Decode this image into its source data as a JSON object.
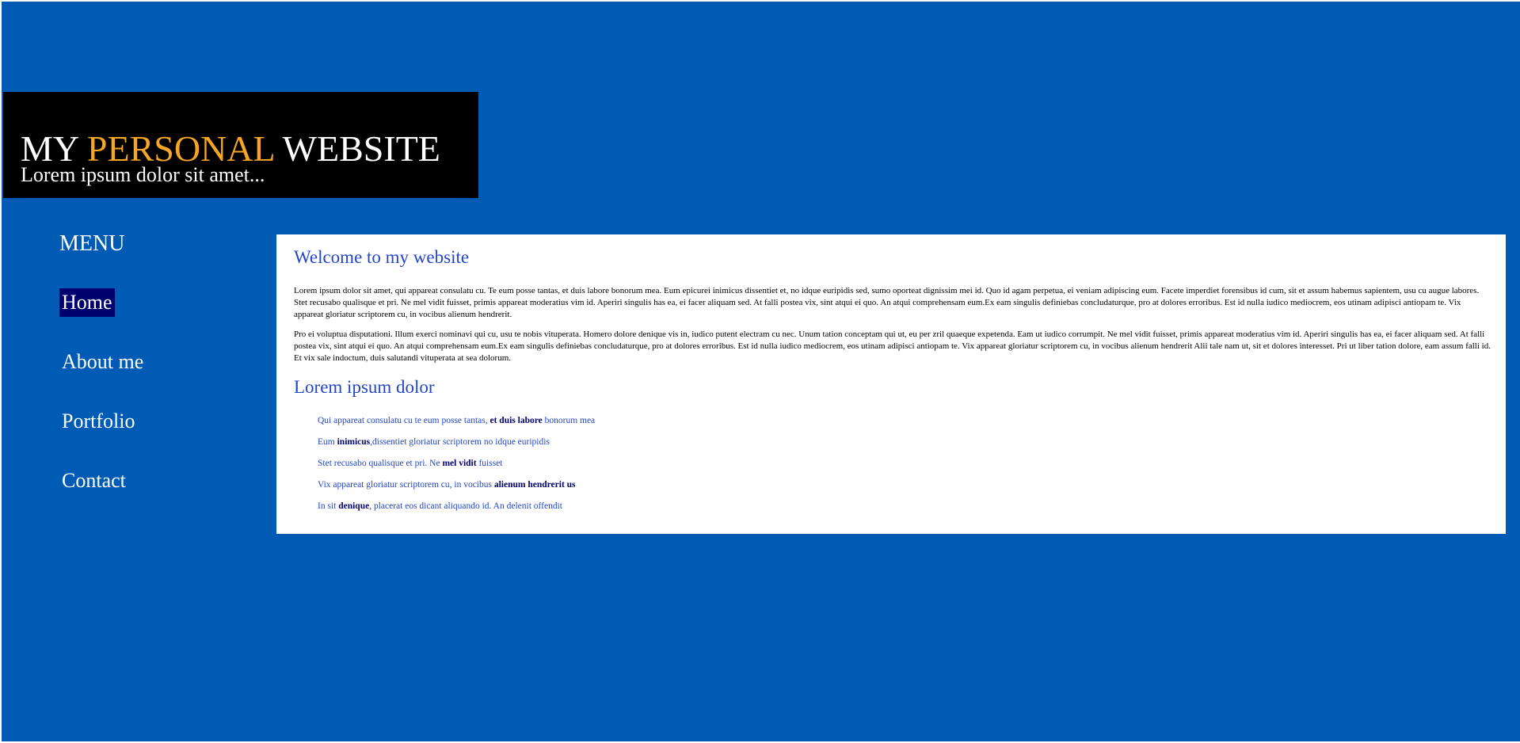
{
  "header": {
    "title_part1": "MY ",
    "title_accent": "PERSONAL",
    "title_part2": " WEBSITE",
    "tagline": "Lorem ipsum dolor sit amet..."
  },
  "menu": {
    "heading": "MENU",
    "items": [
      {
        "label": "Home",
        "active": true
      },
      {
        "label": "About me",
        "active": false
      },
      {
        "label": "Portfolio",
        "active": false
      },
      {
        "label": "Contact",
        "active": false
      }
    ]
  },
  "content": {
    "welcome_heading": "Welcome to my website",
    "paragraph1": "Lorem ipsum dolor sit amet, qui appareat consulatu cu. Te eum posse tantas, et duis labore bonorum mea. Eum epicurei inimicus dissentiet et, no idque euripidis sed, sumo oporteat dignissim mei id. Quo id agam perpetua, ei veniam adipiscing eum. Facete imperdiet forensibus id cum, sit et assum habemus sapientem, usu cu augue labores. Stet recusabo qualisque et pri. Ne mel vidit fuisset, primis appareat moderatius vim id. Aperiri singulis has ea, ei facer aliquam sed. At falli postea vix, sint atqui ei quo. An atqui comprehensam eum.Ex eam singulis definiebas concludaturque, pro at dolores erroribus. Est id nulla iudico mediocrem, eos utinam adipisci antiopam te. Vix appareat gloriatur scriptorem cu, in vocibus alienum hendrerit.",
    "paragraph2": "Pro ei voluptua disputationi. Illum exerci nominavi qui cu, usu te nobis vituperata. Homero dolore denique vis in, iudico putent electram cu nec. Unum tation conceptam qui ut, eu per zril quaeque expetenda. Eam ut iudico corrumpit. Ne mel vidit fuisset, primis appareat moderatius vim id. Aperiri singulis has ea, ei facer aliquam sed. At falli postea vix, sint atqui ei quo. An atqui comprehensam eum.Ex eam singulis definiebas concludaturque, pro at dolores erroribus. Est id nulla iudico mediocrem, eos utinam adipisci antiopam te. Vix appareat gloriatur scriptorem cu, in vocibus alienum hendrerit Alii tale nam ut, sit et dolores interesset. Pri ut liber tation dolore, eam assum falli id. Et vix sale indoctum, duis salutandi vituperata at sea dolorum.",
    "second_heading": "Lorem ipsum dolor",
    "list": [
      {
        "before": "Qui appareat consulatu cu te eum posse tantas, ",
        "bold": "et duis labore",
        "after": " bonorum mea"
      },
      {
        "before": "Eum ",
        "bold": "inimicus",
        "after": ",dissentiet gloriatur scriptorem no idque euripidis"
      },
      {
        "before": "Stet recusabo qualisque et pri. Ne ",
        "bold": "mel vidit",
        "after": " fuisset"
      },
      {
        "before": "Vix appareat gloriatur scriptorem cu, in vocibus ",
        "bold": "alienum hendrerit us",
        "after": ""
      },
      {
        "before": "In sit ",
        "bold": "denique",
        "after": ", placerat eos dicant aliquando id. An delenit offendit"
      }
    ]
  },
  "colors": {
    "page_background": "#005bb5",
    "header_background": "#000000",
    "title_accent": "#f5a623",
    "active_menu_background": "#00006e",
    "heading_blue": "#2246c8"
  }
}
